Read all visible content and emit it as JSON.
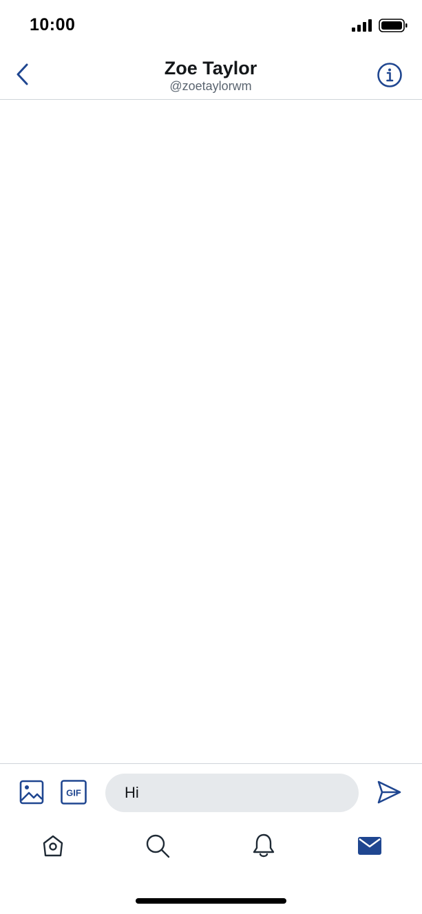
{
  "status_bar": {
    "time": "10:00",
    "signal_icon": "cellular-signal-icon",
    "battery_icon": "battery-full-icon"
  },
  "header": {
    "title": "Zoe Taylor",
    "handle": "@zoetaylorwm",
    "back_icon": "chevron-left-icon",
    "info_icon": "info-circle-icon"
  },
  "composer": {
    "media_icon": "image-icon",
    "gif_label": "GIF",
    "input_value": "Hi",
    "send_icon": "send-icon"
  },
  "tab_bar": {
    "items": [
      {
        "name": "home",
        "icon": "home-icon",
        "active": false
      },
      {
        "name": "search",
        "icon": "search-icon",
        "active": false
      },
      {
        "name": "notifications",
        "icon": "bell-icon",
        "active": false
      },
      {
        "name": "messages",
        "icon": "envelope-icon",
        "active": true
      }
    ]
  },
  "colors": {
    "accent": "#1f4690",
    "text_primary": "#14171a",
    "text_secondary": "#5b6570",
    "input_bg": "#e6e9ec",
    "divider": "#cfd4d9"
  }
}
